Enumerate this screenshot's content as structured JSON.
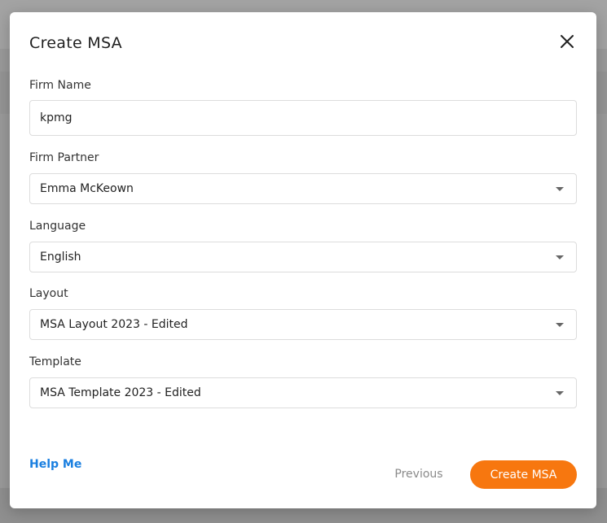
{
  "modal": {
    "title": "Create MSA",
    "close_icon": "close-icon"
  },
  "fields": {
    "firm_name": {
      "label": "Firm Name",
      "value": "kpmg"
    },
    "firm_partner": {
      "label": "Firm Partner",
      "value": "Emma McKeown"
    },
    "language": {
      "label": "Language",
      "value": "English"
    },
    "layout": {
      "label": "Layout",
      "value": "MSA Layout 2023 - Edited"
    },
    "template": {
      "label": "Template",
      "value": "MSA Template 2023 - Edited"
    }
  },
  "footer": {
    "help_label": "Help Me",
    "previous_label": "Previous",
    "create_label": "Create MSA"
  },
  "colors": {
    "accent": "#f7770f",
    "link": "#1a7fe0",
    "muted_button_text": "#8a8a8a"
  }
}
